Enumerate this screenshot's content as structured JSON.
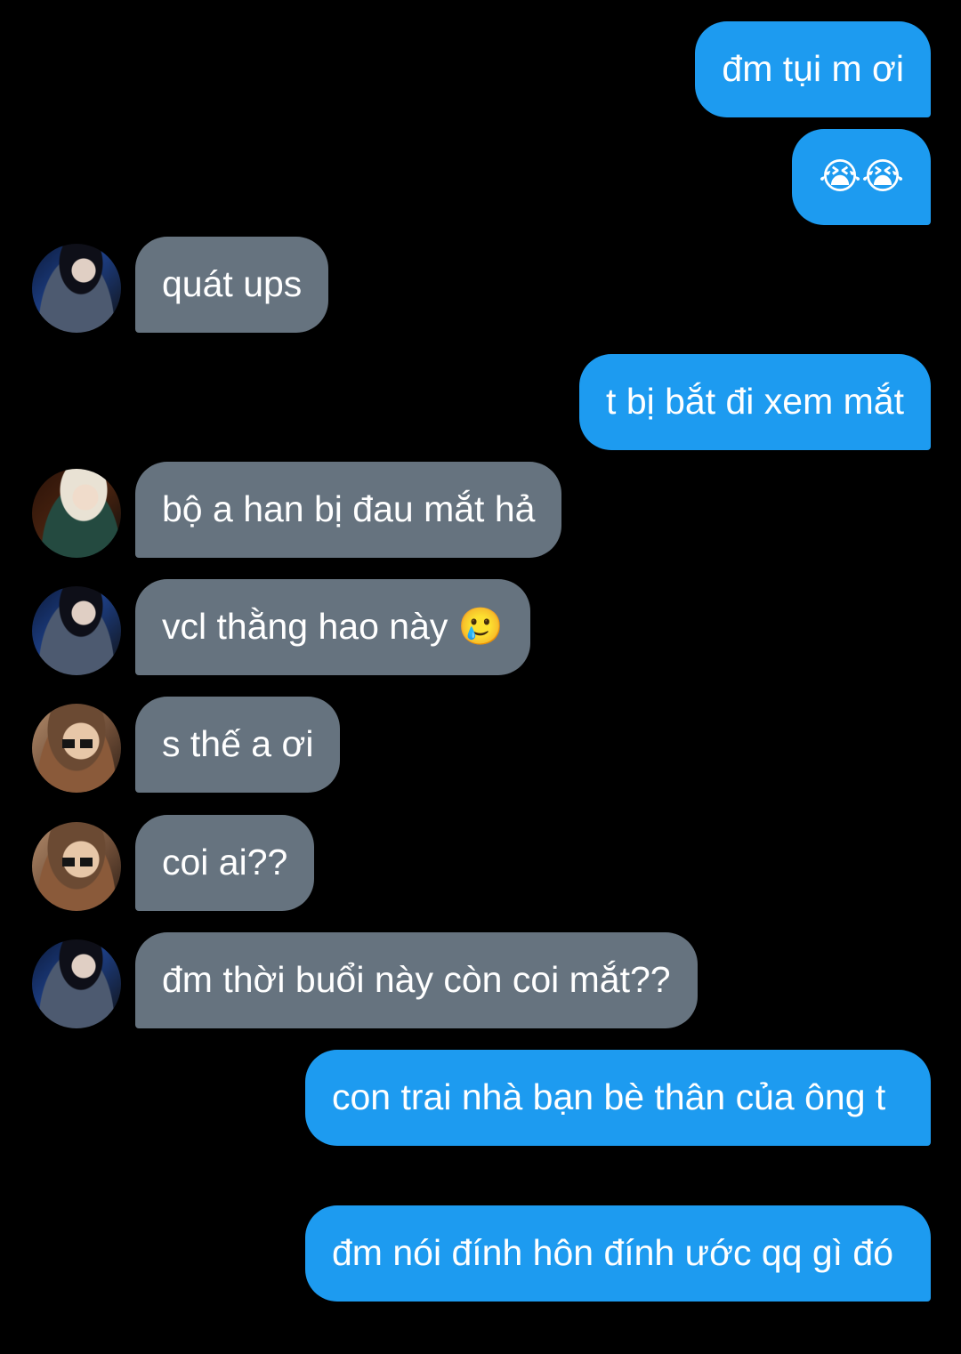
{
  "messages": [
    {
      "direction": "sent",
      "text": "đm tụi m ơi"
    },
    {
      "direction": "sent",
      "text": "😭😭"
    },
    {
      "direction": "received",
      "text": "quát ups",
      "avatar": "avatar-boy-dark-hair"
    },
    {
      "direction": "sent",
      "text": "t bị bắt đi xem mắt"
    },
    {
      "direction": "received",
      "text": "bộ a han bị đau mắt hả",
      "avatar": "avatar-boy-blonde-hair"
    },
    {
      "direction": "received",
      "text": "vcl thằng hao này 🥲",
      "avatar": "avatar-boy-dark-hair"
    },
    {
      "direction": "received",
      "text": "s thế a ơi",
      "avatar": "avatar-boy-sunglasses"
    },
    {
      "direction": "received",
      "text": "coi ai??",
      "avatar": "avatar-boy-sunglasses"
    },
    {
      "direction": "received",
      "text": "đm thời buổi này còn coi mắt??",
      "avatar": "avatar-boy-dark-hair"
    },
    {
      "direction": "sent",
      "text": "con trai nhà bạn bè thân của ông t"
    },
    {
      "direction": "sent",
      "text": "đm nói đính hôn đính ước qq gì đó"
    }
  ],
  "colors": {
    "background": "#000000",
    "sent_bubble": "#1d9bf0",
    "received_bubble": "#66737f",
    "text": "#ffffff"
  }
}
